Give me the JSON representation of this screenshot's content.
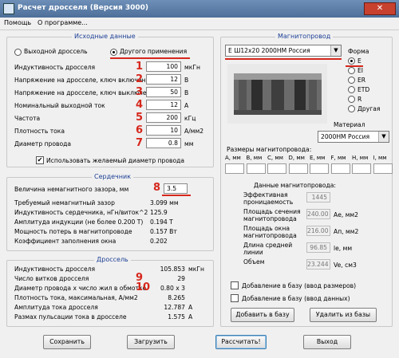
{
  "window": {
    "title": "Расчет дросселя (Версия 3000)",
    "close": "✕"
  },
  "menu": [
    "Помощь",
    "О программе..."
  ],
  "left": {
    "input": {
      "title": "Исходные данные",
      "radio1": "Выходной дроссель",
      "radio2": "Другого применения",
      "rows": [
        {
          "label": "Индуктивность дросселя",
          "num": "1",
          "value": "100",
          "unit": "мкГн"
        },
        {
          "label": "Напряжение на дросселе, ключ включен",
          "num": "2",
          "value": "12",
          "unit": "В"
        },
        {
          "label": "Напряжение на дросселе, ключ выключен",
          "num": "3",
          "value": "50",
          "unit": "В"
        },
        {
          "label": "Номинальный выходной ток",
          "num": "4",
          "value": "12",
          "unit": "А"
        },
        {
          "label": "Частота",
          "num": "5",
          "value": "200",
          "unit": "кГц"
        },
        {
          "label": "Плотность тока",
          "num": "6",
          "value": "10",
          "unit": "А/мм2"
        },
        {
          "label": "Диаметр провода",
          "num": "7",
          "value": "0.8",
          "unit": "мм"
        }
      ],
      "checkbox": "Использовать желаемый диаметр провода",
      "checkbox_mark": "✔"
    },
    "core": {
      "title": "Сердечник",
      "gap_label": "Величина немагнитного зазора, мм",
      "gap_num": "8",
      "gap_value": "3.5",
      "rows": [
        {
          "label": "Требуемый немагнитный зазор",
          "value": "3.099 мм"
        },
        {
          "label": "Индуктивность сердечника, нГн/виток^2",
          "value": "125.9"
        },
        {
          "label": "Амплитуда индукции   (не более 0.200 Т)",
          "value": "0.194 Т"
        },
        {
          "label": "Мощность потерь в магнитопроводе",
          "value": "0.157 Вт"
        },
        {
          "label": "Коэффициент заполнения окна",
          "value": "0.202"
        }
      ]
    },
    "choke": {
      "title": "Дроссель",
      "rows": [
        {
          "label": "Индуктивность дросселя",
          "num": "",
          "value": "105.853",
          "unit": "мкГн"
        },
        {
          "label": "Число витков дросселя",
          "num": "9",
          "value": "29",
          "unit": ""
        },
        {
          "label": "Диаметр провода х число жил в обмотке",
          "num": "10",
          "value": "0.80 х 3",
          "unit": ""
        },
        {
          "label": "Плотность тока, максимальная, А/мм2",
          "num": "",
          "value": "8.265",
          "unit": ""
        },
        {
          "label": "Амплитуда тока дросселя",
          "num": "",
          "value": "12.787",
          "unit": "А"
        },
        {
          "label": "Размах пульсации тока в дросселе",
          "num": "",
          "value": "1.575",
          "unit": "А"
        }
      ]
    }
  },
  "right": {
    "title": "Магнитопровод",
    "core_select": "Е Ш12х20 2000НМ Россия",
    "form_label": "Форма",
    "forms": [
      "E",
      "EI",
      "ER",
      "ETD",
      "R",
      "Другая"
    ],
    "material_label": "Материал",
    "material_select": "2000НМ Россия",
    "sizes_title": "Размеры магнитопровода:",
    "size_cols": [
      "A, мм",
      "B, мм",
      "C, мм",
      "D, мм",
      "E, мм",
      "F, мм",
      "H, мм",
      "I, мм"
    ],
    "data_title": "Данные магнитопровода:",
    "data_rows": [
      {
        "label1": "Эффективная",
        "label2": "проницаемость",
        "value": "1445",
        "unit": ""
      },
      {
        "label1": "Площадь сечения",
        "label2": "магнитопровода",
        "value": "240.00",
        "unit": "Ае, мм2"
      },
      {
        "label1": "Площадь окна",
        "label2": "магнитопровода",
        "value": "216.00",
        "unit": "Ап, мм2"
      },
      {
        "label1": "Длина средней",
        "label2": "линии",
        "value": "96.85",
        "unit": "le, мм"
      },
      {
        "label1": "Объем",
        "label2": "",
        "value": "23.244",
        "unit": "Ve, см3"
      }
    ],
    "chk1": "Добавление в базу (ввод размеров)",
    "chk2": "Добавление в базу (ввод данных)",
    "btn_add": "Добавить в базу",
    "btn_del": "Удалить из базы"
  },
  "buttons": {
    "save": "Сохранить",
    "load": "Загрузить",
    "calc": "Рассчитать!",
    "exit": "Выход"
  }
}
